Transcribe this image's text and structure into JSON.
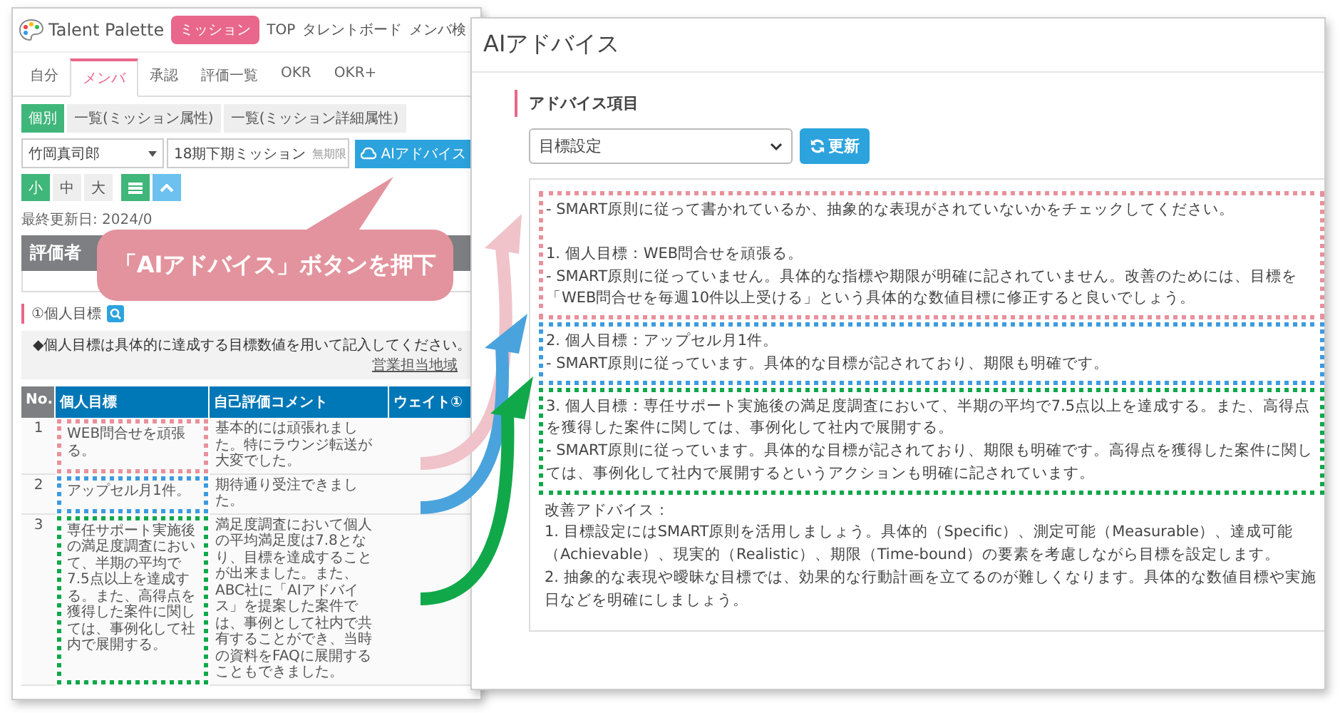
{
  "member_window": {
    "logo": "Talent Palette",
    "nav": [
      {
        "label": "ミッション",
        "selected": true
      },
      {
        "label": "TOP",
        "selected": false
      },
      {
        "label": "タレントボード",
        "selected": false
      },
      {
        "label": "メンバ検",
        "selected": false
      }
    ],
    "tabs": [
      {
        "label": "自分",
        "selected": false
      },
      {
        "label": "メンバ",
        "selected": true
      },
      {
        "label": "承認",
        "selected": false
      },
      {
        "label": "評価一覧",
        "selected": false
      },
      {
        "label": "OKR",
        "selected": false
      },
      {
        "label": "OKR+",
        "selected": false
      }
    ],
    "view_buttons": [
      {
        "label": "個別",
        "selected": true
      },
      {
        "label": "一覧(ミッション属性)",
        "selected": false
      },
      {
        "label": "一覧(ミッション詳細属性)",
        "selected": false
      }
    ],
    "member_select": "竹岡真司郎",
    "mission_select": "18期下期ミッション",
    "mission_tag": "無期限",
    "ai_button": "AIアドバイス",
    "size_buttons": [
      {
        "label": "小",
        "selected": true
      },
      {
        "label": "中",
        "selected": false
      },
      {
        "label": "大",
        "selected": false
      }
    ],
    "last_updated": "最終更新日: 2024/0",
    "evaluator_header": "評価者",
    "section_title": "①個人目標",
    "note": "◆個人目標は具体的に達成する目標数値を用いて記入してください。",
    "note_link": "営業担当地域",
    "table": {
      "columns": [
        "No.",
        "個人目標",
        "自己評価コメント",
        "ウェイト①"
      ],
      "rows": [
        {
          "no": "1",
          "goal": "WEB問合せを頑張る。",
          "comment": "基本的には頑張れました。特にラウンジ転送が大変でした。",
          "color": "#e8919b"
        },
        {
          "no": "2",
          "goal": "アップセル月1件。",
          "comment": "期待通り受注できました。",
          "color": "#3d9be0"
        },
        {
          "no": "3",
          "goal": "専任サポート実施後の満足度調査において、半期の平均で7.5点以上を達成する。また、高得点を獲得した案件に関しては、事例化して社内で展開する。",
          "comment": "満足度調査において個人の平均満足度は7.8となり、目標を達成することが出来ました。また、ABC社に「AIアドバイス」を提案した案件では、事例として社内で共有することができ、当時の資料をFAQに展開することもできました。",
          "color": "#10a84a"
        }
      ]
    }
  },
  "callout": {
    "text": "「AIアドバイス」ボタンを押下"
  },
  "advice_window": {
    "title": "AIアドバイス",
    "section_label": "アドバイス項目",
    "select": "目標設定",
    "refresh_button": "更新",
    "blocks": [
      {
        "color": "#e8919b",
        "lines": [
          "- SMART原則に従って書かれているか、抽象的な表現がされていないかをチェックしてください。",
          "1. 個人目標：WEB問合せを頑張る。",
          "- SMART原則に従っていません。具体的な指標や期限が明確に記されていません。改善のためには、目標を「WEB問合せを毎週10件以上受ける」という具体的な数値目標に修正すると良いでしょう。"
        ]
      },
      {
        "color": "#3d9be0",
        "lines": [
          "2. 個人目標：アップセル月1件。",
          "- SMART原則に従っています。具体的な目標が記されており、期限も明確です。"
        ]
      },
      {
        "color": "#10a84a",
        "lines": [
          "3. 個人目標：専任サポート実施後の満足度調査において、半期の平均で7.5点以上を達成する。また、高得点を獲得した案件に関しては、事例化して社内で展開する。",
          "- SMART原則に従っています。具体的な目標が記されており、期限も明確です。高得点を獲得した案件に関しては、事例化して社内で展開するというアクションも明確に記されています。"
        ]
      }
    ],
    "improvement": [
      "改善アドバイス：",
      "1. 目標設定にはSMART原則を活用しましょう。具体的（Specific）、測定可能（Measurable）、達成可能（Achievable）、現実的（Realistic）、期限（Time-bound）の要素を考慮しながら目標を設定します。",
      "2. 抽象的な表現や曖昧な目標では、効果的な行動計画を立てるのが難しくなります。具体的な数値目標や実施日などを明確にしましょう。"
    ]
  }
}
